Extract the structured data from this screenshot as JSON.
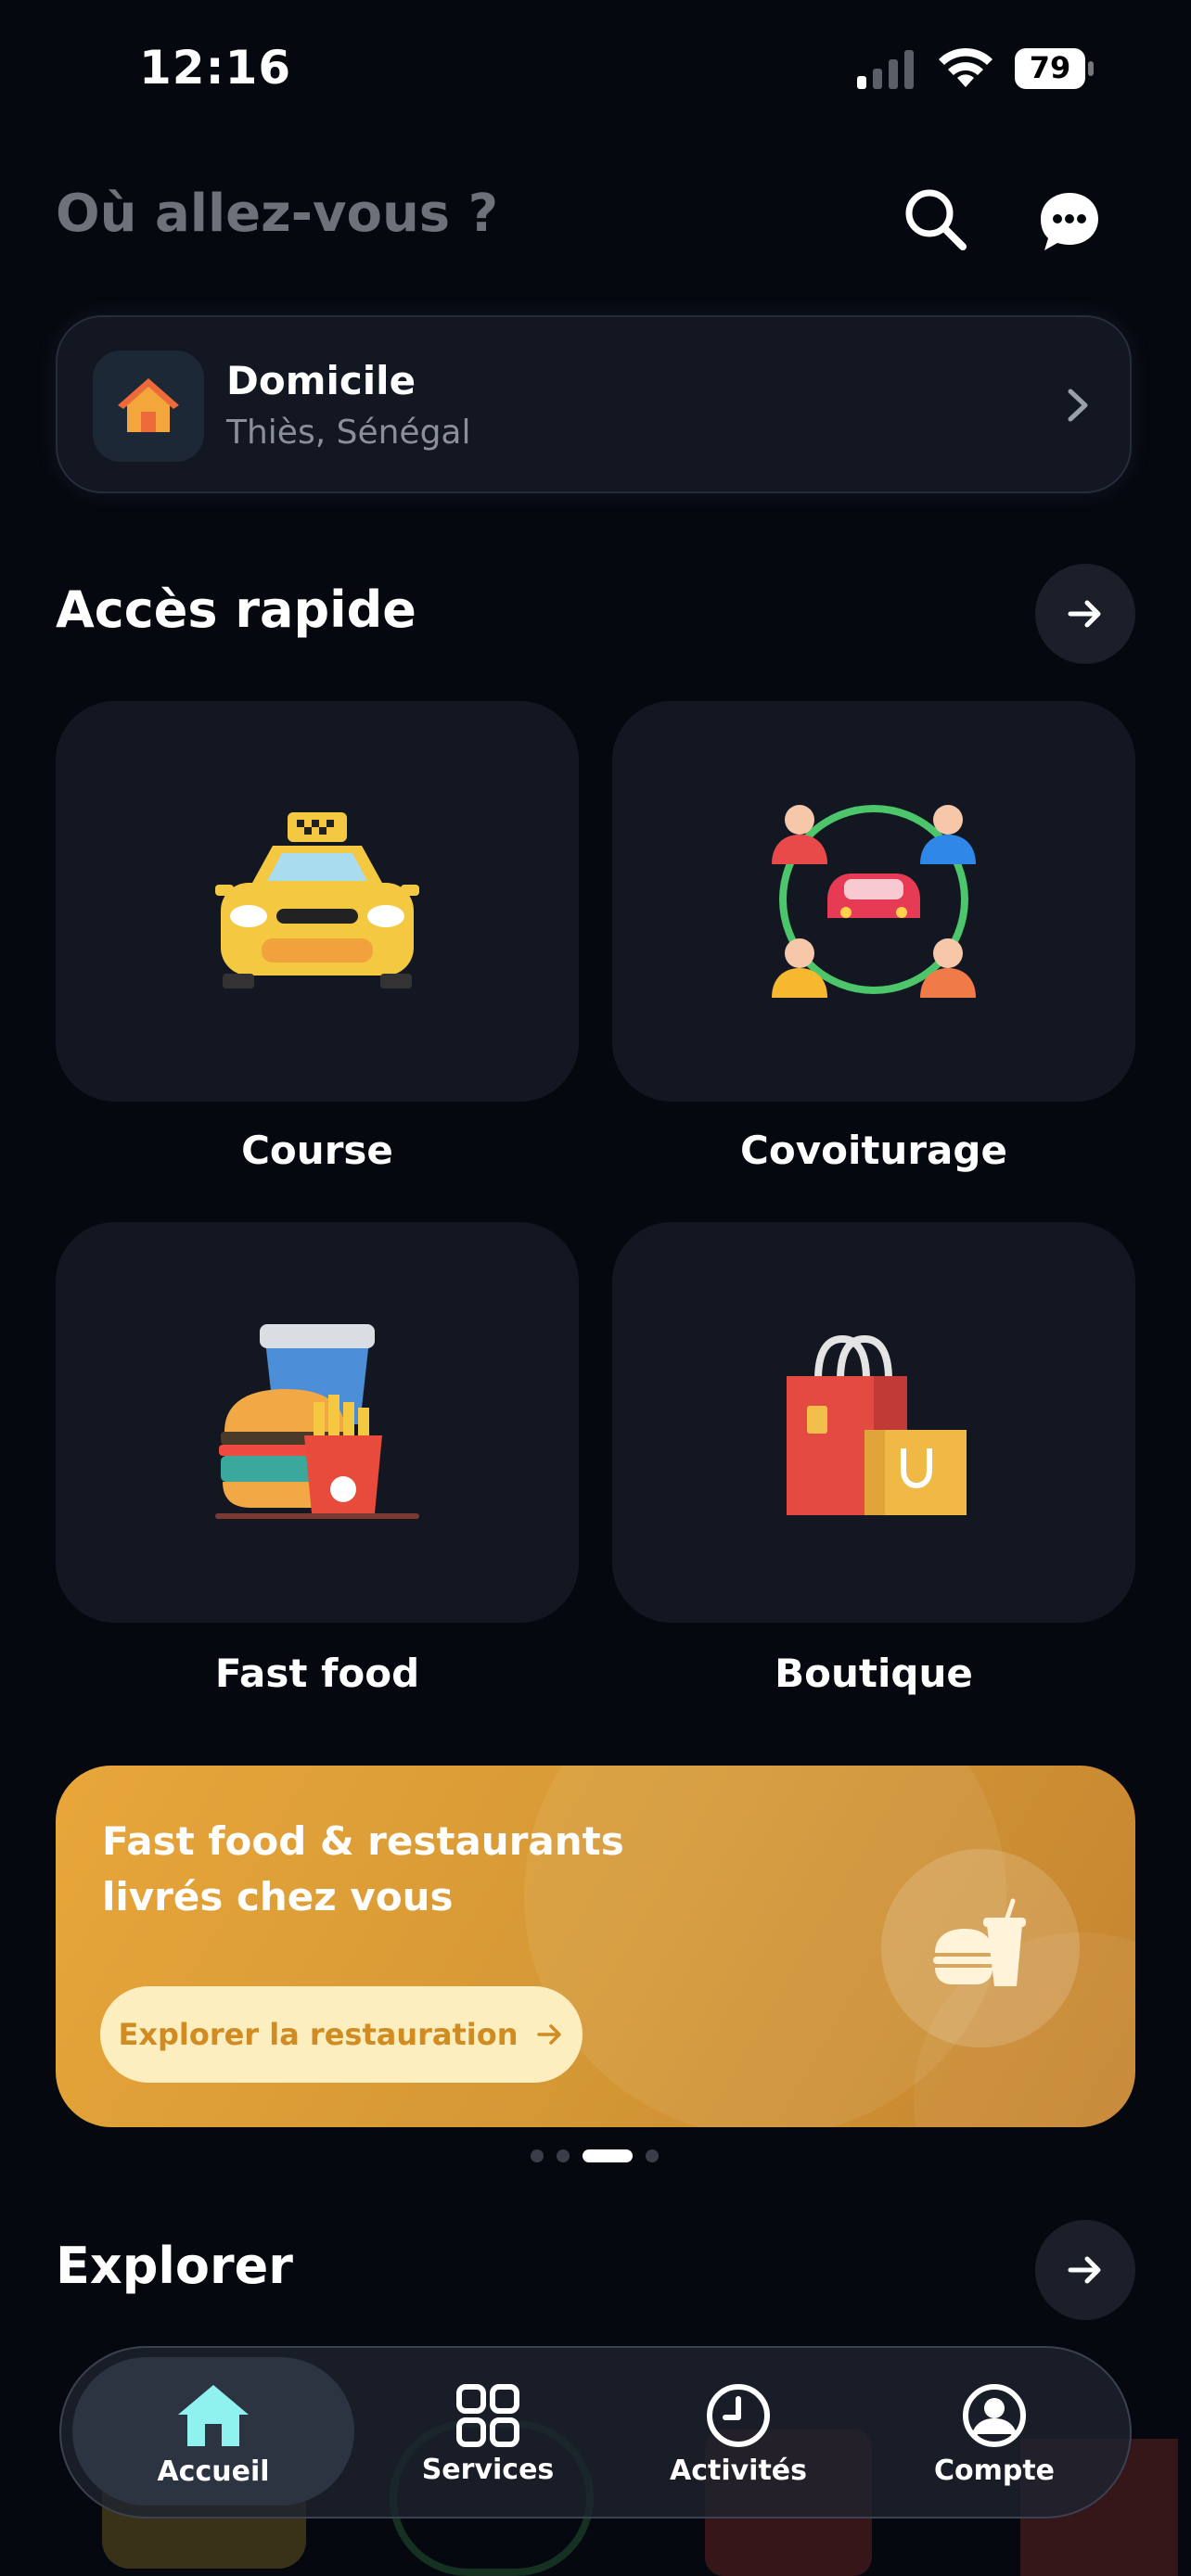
{
  "status_bar": {
    "time": "12:16",
    "battery": "79"
  },
  "header": {
    "search_placeholder": "Où allez-vous ?"
  },
  "home_card": {
    "title": "Domicile",
    "subtitle": "Thiès, Sénégal"
  },
  "quick_access": {
    "title": "Accès rapide",
    "tiles": [
      {
        "label": "Course",
        "icon": "taxi-icon"
      },
      {
        "label": "Covoiturage",
        "icon": "carpool-icon"
      },
      {
        "label": "Fast food",
        "icon": "fast-food-icon"
      },
      {
        "label": "Boutique",
        "icon": "shopping-bags-icon"
      }
    ]
  },
  "promo": {
    "title_line1": "Fast food & restaurants",
    "title_line2": "livrés chez vous",
    "button": "Explorer la restauration",
    "active_slide": 3,
    "slide_count": 4
  },
  "explorer": {
    "title": "Explorer"
  },
  "bottom_nav": {
    "items": [
      {
        "label": "Accueil",
        "icon": "home-icon",
        "active": true
      },
      {
        "label": "Services",
        "icon": "grid-icon",
        "active": false
      },
      {
        "label": "Activités",
        "icon": "clock-icon",
        "active": false
      },
      {
        "label": "Compte",
        "icon": "account-icon",
        "active": false
      }
    ]
  },
  "colors": {
    "background": "#05080f",
    "tile": "#121722",
    "promo": "#e0a039",
    "active_nav_icon": "#8ff2ee"
  }
}
